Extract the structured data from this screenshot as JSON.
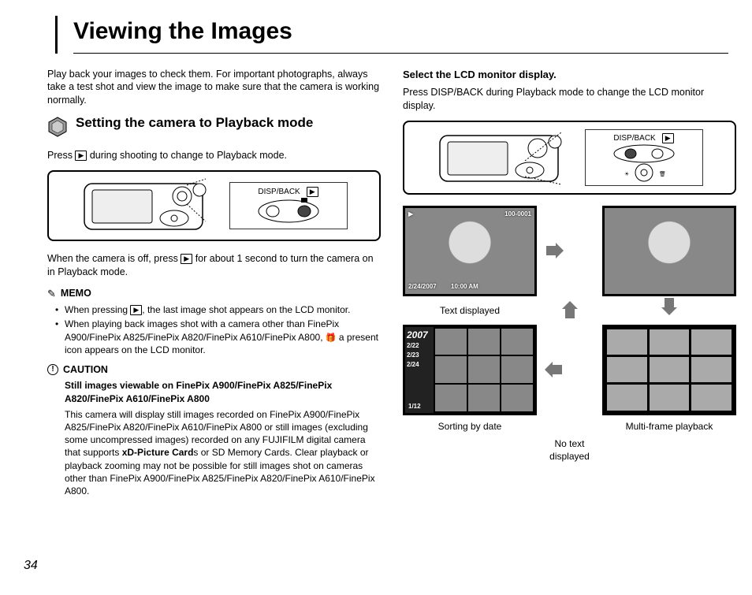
{
  "page_number": "34",
  "title": "Viewing the Images",
  "intro": "Play back your images to check them. For important photographs, always take a test shot and view the image to make sure that the camera is working normally.",
  "section1": {
    "heading": "Setting the camera to Playback mode",
    "line1a": "Press ",
    "line1b": " during shooting to change to Playback mode.",
    "line2a": "When the camera is off, press ",
    "line2b": " for about 1 second to turn the camera on in Playback mode.",
    "button_label": "DISP/BACK"
  },
  "memo": {
    "label": "MEMO",
    "item1a": "When pressing ",
    "item1b": ", the last image shot appears on the LCD monitor.",
    "item2a": "When playing back images shot with a camera other than FinePix A900/FinePix A825/FinePix A820/FinePix A610/FinePix A800, ",
    "item2b": " a present icon appears on the LCD monitor."
  },
  "caution": {
    "label": "CAUTION",
    "subhead": "Still images viewable on FinePix A900/FinePix A825/FinePix A820/FinePix A610/FinePix A800",
    "body1": "This camera will display still images recorded on FinePix A900/FinePix A825/FinePix A820/FinePix A610/FinePix A800 or still images (excluding some uncompressed images) recorded on any FUJIFILM digital camera that supports ",
    "body_bold": "xD-Picture Card",
    "body2": "s or SD Memory Cards. Clear playback or playback zooming may not be possible for still images shot on cameras other than FinePix A900/FinePix A825/FinePix A820/FinePix A610/FinePix A800."
  },
  "right": {
    "heading": "Select the LCD monitor display.",
    "intro": "Press DISP/BACK during Playback mode to change the LCD monitor display.",
    "button_label": "DISP/BACK",
    "labels": {
      "text_displayed": "Text displayed",
      "no_text": "No text displayed",
      "sorting": "Sorting by date",
      "multi": "Multi-frame playback"
    },
    "screen_text": {
      "frame_no": "100-0001",
      "date": "2/24/2007",
      "time": "10:00 AM",
      "year": "2007",
      "d1": "2/22",
      "d2": "2/23",
      "d3": "2/24",
      "page": "1/12"
    }
  }
}
